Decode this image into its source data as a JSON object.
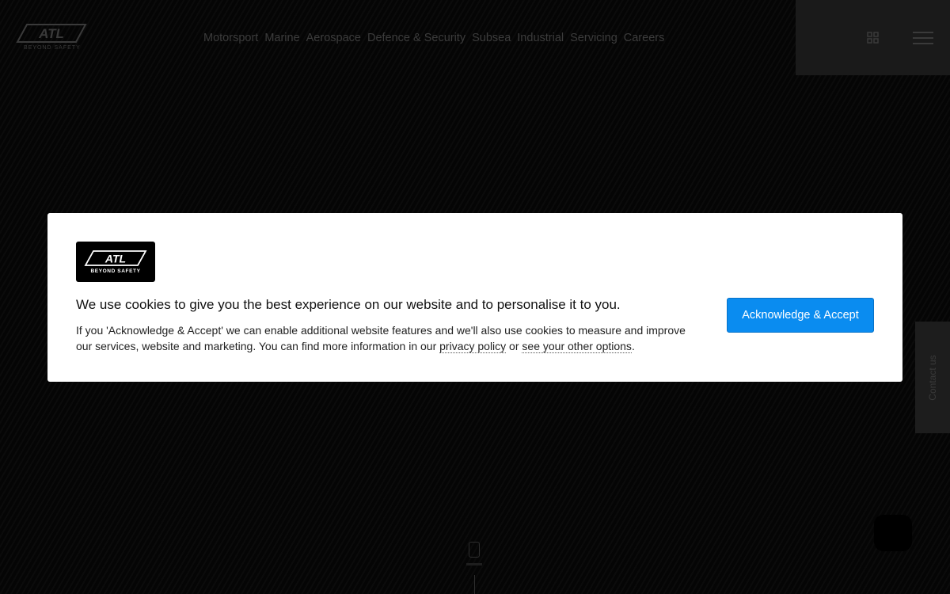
{
  "brand": {
    "logo_text": "ATL",
    "tagline": "BEYOND SAFETY"
  },
  "nav": {
    "items": [
      "Motorsport",
      "Marine",
      "Aerospace",
      "Defence & Security",
      "Subsea",
      "Industrial",
      "Servicing",
      "Careers"
    ]
  },
  "header": {
    "grid_icon": "grid-icon",
    "menu_icon": "hamburger-menu-icon"
  },
  "side_tab": {
    "label": "Contact us"
  },
  "cookie": {
    "title": "We use cookies to give you the best experience on our website and to personalise it to you.",
    "body_prefix": "If you 'Acknowledge & Accept' we can enable additional website features and we'll also use cookies to measure and improve our services, website and marketing. You can find more information in our ",
    "privacy_link": "privacy policy",
    "body_middle": " or ",
    "options_link": "see your other options",
    "body_suffix": ".",
    "accept_label": "Acknowledge & Accept"
  },
  "colors": {
    "accent": "#0a8cf0",
    "background": "#060606",
    "banner": "#ffffff"
  }
}
